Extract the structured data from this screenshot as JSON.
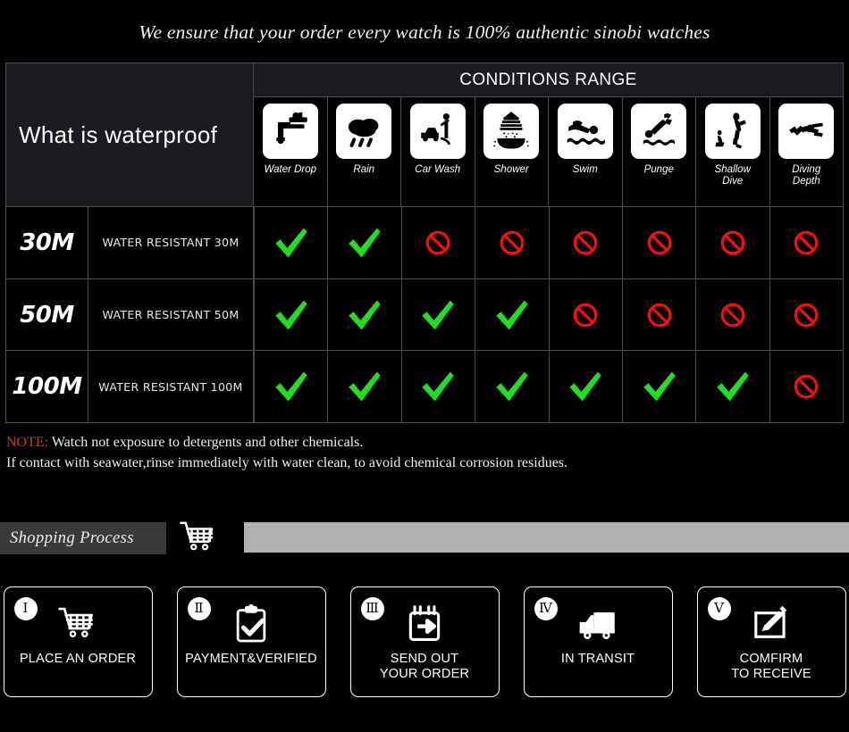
{
  "headline": "We ensure that your order every watch is 100% authentic sinobi watches",
  "table": {
    "left_header": "What is waterproof",
    "conditions_title": "CONDITIONS RANGE",
    "columns": [
      {
        "label": "Water Drop",
        "icon": "faucet-drop-icon"
      },
      {
        "label": "Rain",
        "icon": "rain-cloud-icon"
      },
      {
        "label": "Car Wash",
        "icon": "car-wash-icon"
      },
      {
        "label": "Shower",
        "icon": "shower-bath-icon"
      },
      {
        "label": "Swim",
        "icon": "swimmer-icon"
      },
      {
        "label": "Punge",
        "icon": "plunge-dive-icon"
      },
      {
        "label": "Shallow\nDive",
        "icon": "shallow-dive-icon"
      },
      {
        "label": "Diving\nDepth",
        "icon": "scuba-diver-icon"
      }
    ],
    "rows": [
      {
        "depth": "30M",
        "description": "WATER RESISTANT  30M",
        "marks": [
          "check",
          "check",
          "ban",
          "ban",
          "ban",
          "ban",
          "ban",
          "ban"
        ]
      },
      {
        "depth": "50M",
        "description": "WATER RESISTANT 50M",
        "marks": [
          "check",
          "check",
          "check",
          "check",
          "ban",
          "ban",
          "ban",
          "ban"
        ]
      },
      {
        "depth": "100M",
        "description": "WATER RESISTANT  100M",
        "marks": [
          "check",
          "check",
          "check",
          "check",
          "check",
          "check",
          "check",
          "ban"
        ]
      }
    ]
  },
  "note": {
    "tag": "NOTE:",
    "line1": " Watch not exposure to detergents and other chemicals.",
    "line2": "If contact with seawater,rinse immediately with water clean, to avoid chemical corrosion residues."
  },
  "shopping_process": {
    "title": "Shopping Process",
    "cart_icon": "shopping-cart-icon"
  },
  "steps": [
    {
      "numeral": "Ⅰ",
      "label": "PLACE AN ORDER",
      "icon": "shopping-cart-icon"
    },
    {
      "numeral": "Ⅱ",
      "label": "PAYMENT&VERIFIED",
      "icon": "clipboard-check-icon"
    },
    {
      "numeral": "Ⅲ",
      "label": "SEND OUT\nYOUR ORDER",
      "icon": "package-arrow-icon"
    },
    {
      "numeral": "Ⅳ",
      "label": "IN TRANSIT",
      "icon": "delivery-truck-icon"
    },
    {
      "numeral": "Ⅴ",
      "label": "COMFIRM\nTO RECEIVE",
      "icon": "sign-pencil-icon"
    }
  ],
  "colors": {
    "background": "#000000",
    "check_green": "#22dd22",
    "ban_red": "#ee1111",
    "note_tag": "#c5441b",
    "grid_line": "#4a4d52",
    "header_fill": "#1a1c20",
    "band_dark": "#3a3a3a",
    "band_grey": "#b1b1b1"
  }
}
